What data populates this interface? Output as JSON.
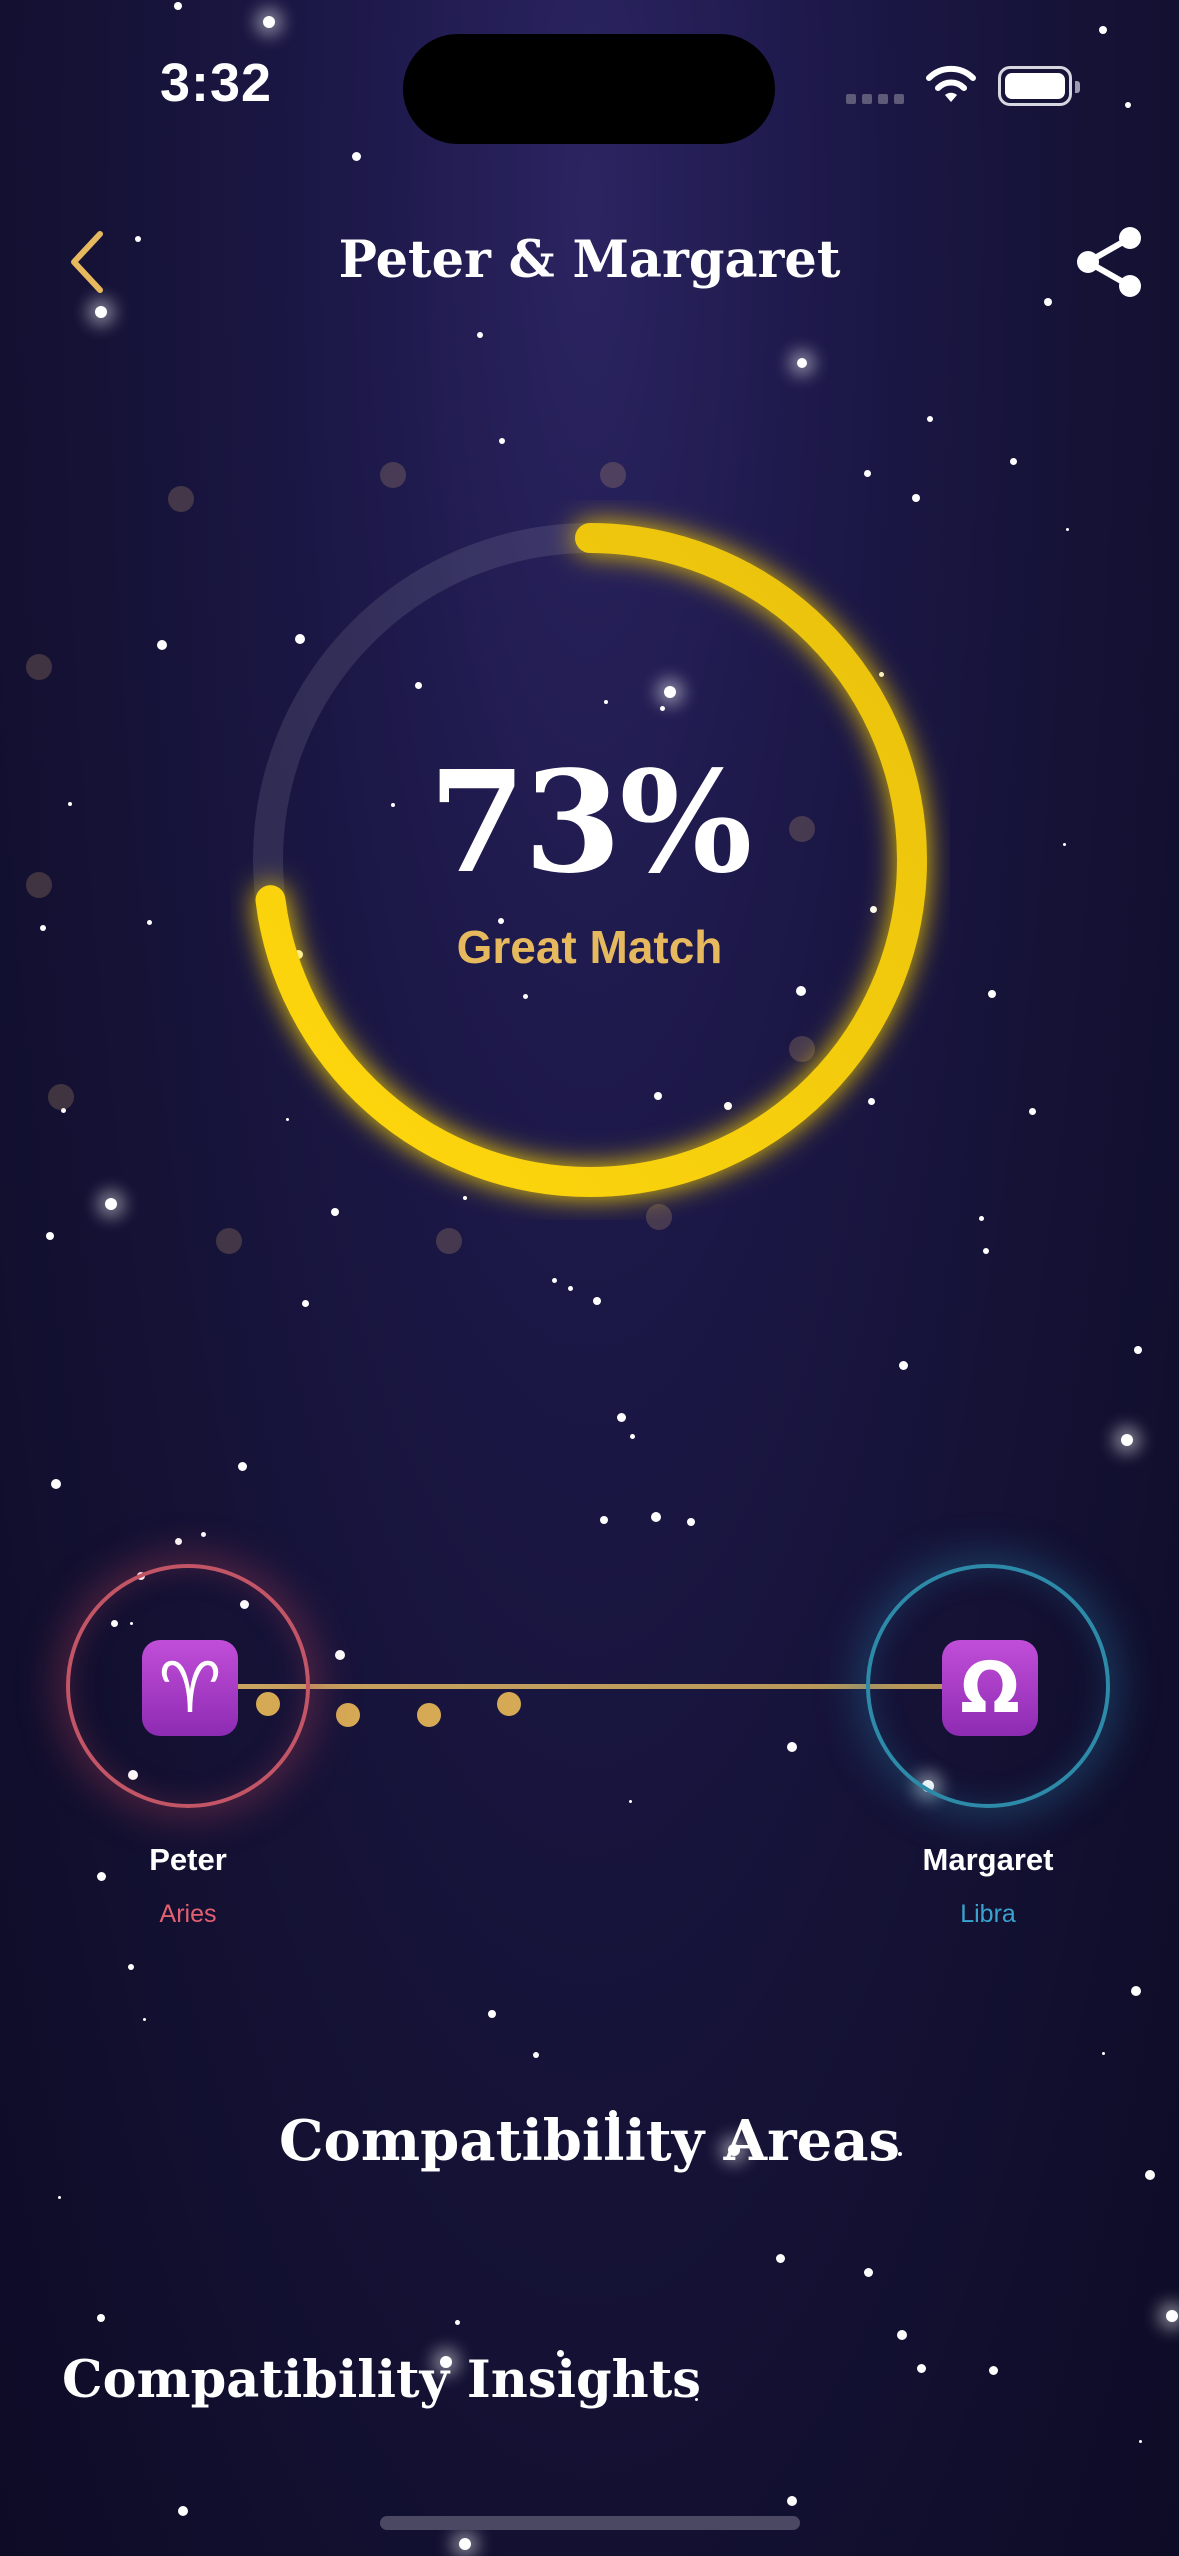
{
  "status": {
    "time": "3:32"
  },
  "header": {
    "title": "Peter & Margaret",
    "back_icon": "chevron-left-icon",
    "share_icon": "share-icon"
  },
  "match": {
    "percent": "73%",
    "value": 73,
    "label": "Great Match"
  },
  "people": [
    {
      "name": "Peter",
      "sign": "Aries",
      "symbol": "♈"
    },
    {
      "name": "Margaret",
      "sign": "Libra",
      "symbol": "Ω"
    }
  ],
  "sections": {
    "areas_title": "Compatibility Areas",
    "insights_title": "Compatibility Insights"
  },
  "colors": {
    "accent": "#e7b95e",
    "ring": "#f7d10d",
    "aries": "#e36070",
    "libra": "#3aa3cf"
  }
}
